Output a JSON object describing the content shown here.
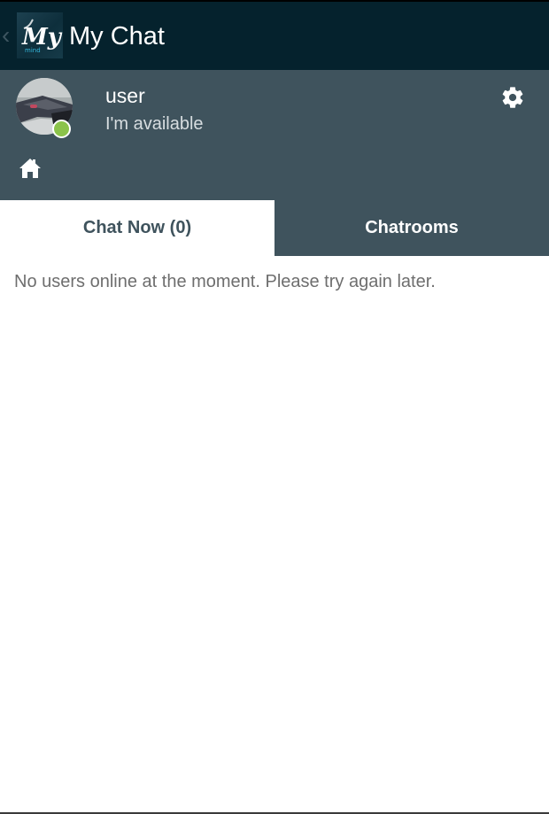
{
  "app_bar": {
    "title": "My Chat",
    "logo_text": "My",
    "logo_subtext": "mind"
  },
  "profile": {
    "user_name": "user",
    "status_text": "I'm available",
    "status_color": "#8bc34a"
  },
  "tabs": [
    {
      "label": "Chat Now (0)",
      "selected": true
    },
    {
      "label": "Chatrooms",
      "selected": false
    }
  ],
  "content": {
    "empty_message": "No users online at the moment. Please try again later."
  },
  "colors": {
    "app_bar_bg": "#05222d",
    "profile_bg": "#3f535d",
    "online_dot": "#8bc34a"
  },
  "icons": {
    "back": "chevron-left-icon",
    "settings": "gear-icon",
    "home": "home-icon"
  }
}
